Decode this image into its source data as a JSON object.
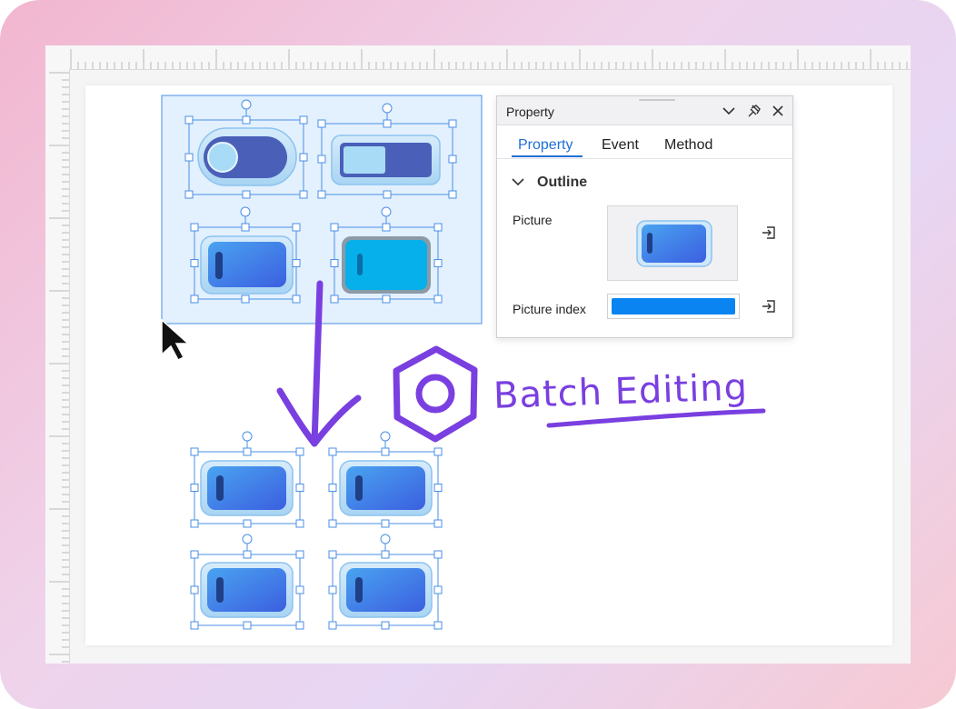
{
  "panel": {
    "title": "Property",
    "tabs": [
      {
        "label": "Property",
        "active": true
      },
      {
        "label": "Event",
        "active": false
      },
      {
        "label": "Method",
        "active": false
      }
    ],
    "section": "Outline",
    "rows": [
      {
        "label": "Picture"
      },
      {
        "label": "Picture index",
        "value_fraction": 1.0
      }
    ],
    "icons": [
      "chevron-down-icon",
      "pin-icon",
      "close-icon",
      "import-icon"
    ]
  },
  "annotation": {
    "text": "Batch Editing",
    "color": "#7a3fe0"
  },
  "colors": {
    "selection_fill": "#e3f0fd",
    "selection_border": "#4a8fe6",
    "accent": "#1f6fd6",
    "switch_blue": "#3b6ee6",
    "switch_cyan": "#06b0ea"
  }
}
